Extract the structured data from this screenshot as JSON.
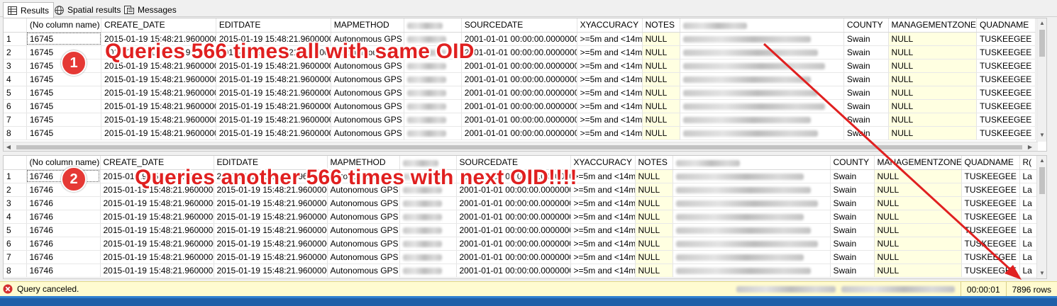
{
  "tabs": [
    {
      "label": "Results",
      "icon": "grid-icon",
      "active": true
    },
    {
      "label": "Spatial results",
      "icon": "globe-icon",
      "active": false
    },
    {
      "label": "Messages",
      "icon": "messages-icon",
      "active": false
    }
  ],
  "grid1": {
    "columns": [
      "",
      "(No column name)",
      "CREATE_DATE",
      "EDITDATE",
      "MAPMETHOD",
      "",
      "SOURCEDATE",
      "XYACCURACY",
      "NOTES",
      "",
      "COUNTY",
      "MANAGEMENTZONE",
      "QUADNAME"
    ],
    "rows": [
      {
        "n": "1",
        "oid": "16745",
        "create": "2015-01-19 15:48:21.9600000",
        "edit": "2015-01-19 15:48:21.9600000",
        "method": "Autonomous GPS",
        "source": "2001-01-01 00:00:00.0000000",
        "xy": ">=5m and <14m",
        "notes": "NULL",
        "county": "Swain",
        "mz": "NULL",
        "quad": "TUSKEEGEE"
      },
      {
        "n": "2",
        "oid": "16745",
        "create": "2015-01-19 15:48:21.9600000",
        "edit": "2015-01-19 15:48:21.9600000",
        "method": "Autonomous GPS",
        "source": "2001-01-01 00:00:00.0000000",
        "xy": ">=5m and <14m",
        "notes": "NULL",
        "county": "Swain",
        "mz": "NULL",
        "quad": "TUSKEEGEE"
      },
      {
        "n": "3",
        "oid": "16745",
        "create": "2015-01-19 15:48:21.9600000",
        "edit": "2015-01-19 15:48:21.9600000",
        "method": "Autonomous GPS",
        "source": "2001-01-01 00:00:00.0000000",
        "xy": ">=5m and <14m",
        "notes": "NULL",
        "county": "Swain",
        "mz": "NULL",
        "quad": "TUSKEEGEE"
      },
      {
        "n": "4",
        "oid": "16745",
        "create": "2015-01-19 15:48:21.9600000",
        "edit": "2015-01-19 15:48:21.9600000",
        "method": "Autonomous GPS",
        "source": "2001-01-01 00:00:00.0000000",
        "xy": ">=5m and <14m",
        "notes": "NULL",
        "county": "Swain",
        "mz": "NULL",
        "quad": "TUSKEEGEE"
      },
      {
        "n": "5",
        "oid": "16745",
        "create": "2015-01-19 15:48:21.9600000",
        "edit": "2015-01-19 15:48:21.9600000",
        "method": "Autonomous GPS",
        "source": "2001-01-01 00:00:00.0000000",
        "xy": ">=5m and <14m",
        "notes": "NULL",
        "county": "Swain",
        "mz": "NULL",
        "quad": "TUSKEEGEE"
      },
      {
        "n": "6",
        "oid": "16745",
        "create": "2015-01-19 15:48:21.9600000",
        "edit": "2015-01-19 15:48:21.9600000",
        "method": "Autonomous GPS",
        "source": "2001-01-01 00:00:00.0000000",
        "xy": ">=5m and <14m",
        "notes": "NULL",
        "county": "Swain",
        "mz": "NULL",
        "quad": "TUSKEEGEE"
      },
      {
        "n": "7",
        "oid": "16745",
        "create": "2015-01-19 15:48:21.9600000",
        "edit": "2015-01-19 15:48:21.9600000",
        "method": "Autonomous GPS",
        "source": "2001-01-01 00:00:00.0000000",
        "xy": ">=5m and <14m",
        "notes": "NULL",
        "county": "Swain",
        "mz": "NULL",
        "quad": "TUSKEEGEE"
      },
      {
        "n": "8",
        "oid": "16745",
        "create": "2015-01-19 15:48:21.9600000",
        "edit": "2015-01-19 15:48:21.9600000",
        "method": "Autonomous GPS",
        "source": "2001-01-01 00:00:00.0000000",
        "xy": ">=5m and <14m",
        "notes": "NULL",
        "county": "Swain",
        "mz": "NULL",
        "quad": "TUSKEEGEE"
      }
    ]
  },
  "grid2": {
    "columns": [
      "",
      "(No column name)",
      "CREATE_DATE",
      "EDITDATE",
      "MAPMETHOD",
      "",
      "SOURCEDATE",
      "XYACCURACY",
      "NOTES",
      "",
      "COUNTY",
      "MANAGEMENTZONE",
      "QUADNAME",
      "R("
    ],
    "rows": [
      {
        "n": "1",
        "oid": "16746",
        "create": "2015-01-19 15:48:21.9600000",
        "edit": "2015-01-19 15:48:21.9600000",
        "method": "Autonomous GPS",
        "source": "2001-01-01 00:00:00.0000000",
        "xy": ">=5m and <14m",
        "notes": "NULL",
        "county": "Swain",
        "mz": "NULL",
        "quad": "TUSKEEGEE",
        "r": "La"
      },
      {
        "n": "2",
        "oid": "16746",
        "create": "2015-01-19 15:48:21.9600000",
        "edit": "2015-01-19 15:48:21.9600000",
        "method": "Autonomous GPS",
        "source": "2001-01-01 00:00:00.0000000",
        "xy": ">=5m and <14m",
        "notes": "NULL",
        "county": "Swain",
        "mz": "NULL",
        "quad": "TUSKEEGEE",
        "r": "La"
      },
      {
        "n": "3",
        "oid": "16746",
        "create": "2015-01-19 15:48:21.9600000",
        "edit": "2015-01-19 15:48:21.9600000",
        "method": "Autonomous GPS",
        "source": "2001-01-01 00:00:00.0000000",
        "xy": ">=5m and <14m",
        "notes": "NULL",
        "county": "Swain",
        "mz": "NULL",
        "quad": "TUSKEEGEE",
        "r": "La"
      },
      {
        "n": "4",
        "oid": "16746",
        "create": "2015-01-19 15:48:21.9600000",
        "edit": "2015-01-19 15:48:21.9600000",
        "method": "Autonomous GPS",
        "source": "2001-01-01 00:00:00.0000000",
        "xy": ">=5m and <14m",
        "notes": "NULL",
        "county": "Swain",
        "mz": "NULL",
        "quad": "TUSKEEGEE",
        "r": "La"
      },
      {
        "n": "5",
        "oid": "16746",
        "create": "2015-01-19 15:48:21.9600000",
        "edit": "2015-01-19 15:48:21.9600000",
        "method": "Autonomous GPS",
        "source": "2001-01-01 00:00:00.0000000",
        "xy": ">=5m and <14m",
        "notes": "NULL",
        "county": "Swain",
        "mz": "NULL",
        "quad": "TUSKEEGEE",
        "r": "La"
      },
      {
        "n": "6",
        "oid": "16746",
        "create": "2015-01-19 15:48:21.9600000",
        "edit": "2015-01-19 15:48:21.9600000",
        "method": "Autonomous GPS",
        "source": "2001-01-01 00:00:00.0000000",
        "xy": ">=5m and <14m",
        "notes": "NULL",
        "county": "Swain",
        "mz": "NULL",
        "quad": "TUSKEEGEE",
        "r": "La"
      },
      {
        "n": "7",
        "oid": "16746",
        "create": "2015-01-19 15:48:21.9600000",
        "edit": "2015-01-19 15:48:21.9600000",
        "method": "Autonomous GPS",
        "source": "2001-01-01 00:00:00.0000000",
        "xy": ">=5m and <14m",
        "notes": "NULL",
        "county": "Swain",
        "mz": "NULL",
        "quad": "TUSKEEGEE",
        "r": "La"
      },
      {
        "n": "8",
        "oid": "16746",
        "create": "2015-01-19 15:48:21.9600000",
        "edit": "2015-01-19 15:48:21.9600000",
        "method": "Autonomous GPS",
        "source": "2001-01-01 00:00:00.0000000",
        "xy": ">=5m and <14m",
        "notes": "NULL",
        "county": "Swain",
        "mz": "NULL",
        "quad": "TUSKEEGEE",
        "r": "La"
      }
    ]
  },
  "annotations": {
    "badge1": "1",
    "text1": "Queries 566 times all with same OID",
    "badge2": "2",
    "text2": "Queries another 566 times with next OID!!!!",
    "color": "#e02020"
  },
  "status": {
    "message": "Query canceled.",
    "elapsed": "00:00:01",
    "rows": "7896 rows",
    "icon": "error-icon"
  }
}
